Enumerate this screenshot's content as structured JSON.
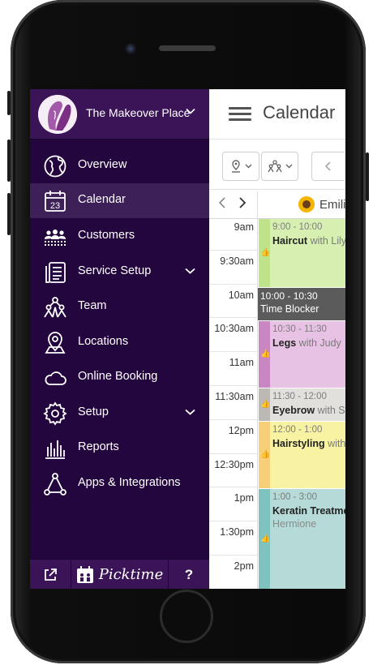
{
  "app": {
    "business_name": "The Makeover Place",
    "page_title": "Calendar",
    "brand": "Picktime"
  },
  "sidebar": {
    "items": [
      {
        "label": "Overview",
        "icon": "globe-icon"
      },
      {
        "label": "Calendar",
        "icon": "calendar-icon",
        "icon_text": "23",
        "active": true
      },
      {
        "label": "Customers",
        "icon": "customers-icon"
      },
      {
        "label": "Service Setup",
        "icon": "service-setup-icon",
        "has_submenu": true
      },
      {
        "label": "Team",
        "icon": "team-icon"
      },
      {
        "label": "Locations",
        "icon": "location-pin-icon"
      },
      {
        "label": "Online Booking",
        "icon": "cloud-icon"
      },
      {
        "label": "Setup",
        "icon": "gear-icon",
        "has_submenu": true
      },
      {
        "label": "Reports",
        "icon": "bar-chart-icon"
      },
      {
        "label": "Apps & Integrations",
        "icon": "integrations-icon"
      }
    ],
    "footer": {
      "external_icon": "external-link-icon",
      "help": "?"
    }
  },
  "calendar": {
    "staff_name": "Emili",
    "time_slots": [
      "9am",
      "9:30am",
      "10am",
      "10:30am",
      "11am",
      "11:30am",
      "12pm",
      "12:30pm",
      "1pm",
      "1:30pm",
      "2pm"
    ],
    "appointments": [
      {
        "time": "9:00 - 10:00",
        "service": "Haircut",
        "customer": "with Lily",
        "color": "#d7f0b2",
        "bar": "#bfe38a"
      },
      {
        "time": "10:00 - 10:30",
        "service": "Time Blocker",
        "customer": "",
        "color": "#5b5b5b",
        "bar": "#5b5b5b",
        "blocker": true
      },
      {
        "time": "10:30 - 11:30",
        "service": "Legs",
        "customer": "with Judy",
        "color": "#e8c2e4",
        "bar": "#c886c2"
      },
      {
        "time": "11:30 - 12:00",
        "service": "Eyebrow",
        "customer": "with Ste",
        "color": "#e2e0dd",
        "bar": "#bcb8b4"
      },
      {
        "time": "12:00 - 1:00",
        "service": "Hairstyling",
        "customer": "with",
        "color": "#f8f2a3",
        "bar": "#f7cf78"
      },
      {
        "time": "1:00 - 3:00",
        "service": "Keratin Treatmen",
        "customer": "Hermione",
        "color": "#b5dad7",
        "bar": "#7fc3c0"
      }
    ]
  },
  "colors": {
    "sidebar_bg": "#24063e",
    "sidebar_header": "#3a1456",
    "active_item": "#3d2058"
  }
}
